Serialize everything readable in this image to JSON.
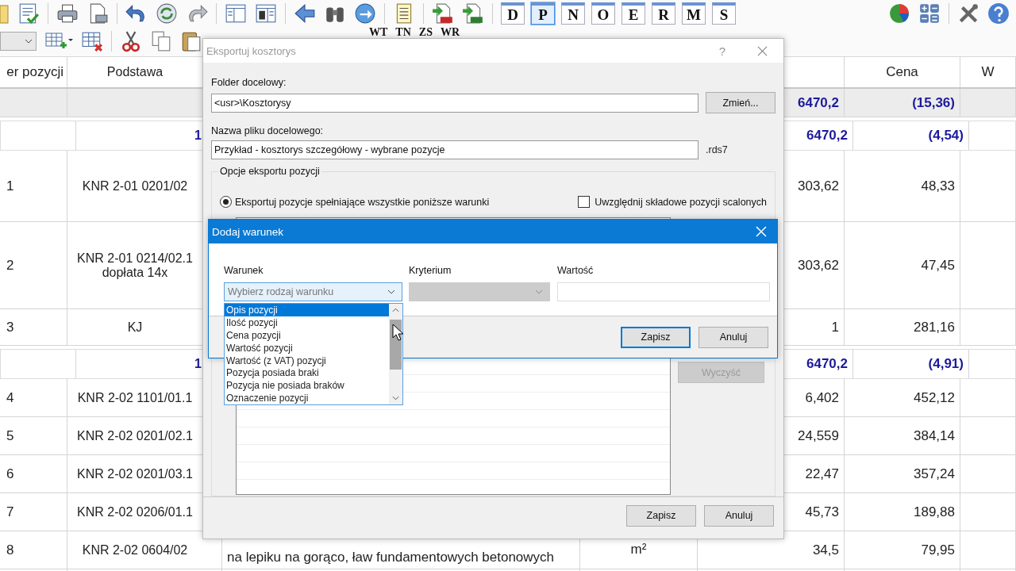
{
  "toolbar": {
    "letter_buttons": [
      {
        "label": "D",
        "selected": false
      },
      {
        "label": "P",
        "selected": true
      },
      {
        "label": "N",
        "selected": false
      },
      {
        "label": "O",
        "selected": false
      },
      {
        "label": "E",
        "selected": false
      },
      {
        "label": "R",
        "selected": false
      },
      {
        "label": "M",
        "selected": false
      },
      {
        "label": "S",
        "selected": false
      }
    ],
    "text_buttons": [
      "WT",
      "TN",
      "ZS",
      "WR"
    ]
  },
  "table": {
    "header": {
      "number": "er pozycji",
      "basis": "Podstawa",
      "price": "Cena",
      "column_7": "W"
    },
    "rows": [
      {
        "kind": "summary",
        "quantity": "6470,2",
        "price": "(15,36)"
      },
      {
        "kind": "group",
        "basis": "1",
        "quantity": "6470,2",
        "price": "(4,54)"
      },
      {
        "kind": "item",
        "number": "1",
        "basis": "KNR 2-01 0201/02",
        "quantity": "303,62",
        "price": "48,33"
      },
      {
        "kind": "item",
        "number": "2",
        "basis": "KNR 2-01 0214/02.1\ndopłata 14x",
        "quantity": "303,62",
        "price": "47,45"
      },
      {
        "kind": "item",
        "number": "3",
        "basis": "KJ",
        "quantity": "1",
        "price": "281,16"
      },
      {
        "kind": "group",
        "basis": "1",
        "quantity": "6470,2",
        "price": "(4,91)"
      },
      {
        "kind": "item",
        "number": "4",
        "basis": "KNR 2-02 1101/01.1",
        "quantity": "6,402",
        "price": "452,12"
      },
      {
        "kind": "item",
        "number": "5",
        "basis": "KNR 2-02 0201/02.1",
        "quantity": "24,559",
        "price": "384,14"
      },
      {
        "kind": "item",
        "number": "6",
        "basis": "KNR 2-02 0201/03.1",
        "quantity": "22,47",
        "price": "357,24"
      },
      {
        "kind": "item",
        "number": "7",
        "basis": "KNR 2-02 0206/01.1",
        "quantity": "45,73",
        "price": "189,88"
      },
      {
        "kind": "item",
        "number": "8",
        "basis": "KNR 2-02 0604/02",
        "description": "na lepiku na gorąco, ław fundamentowych betonowych",
        "unit": "m²",
        "quantity": "34,5",
        "price": "79,95"
      },
      {
        "kind": "item"
      }
    ]
  },
  "export_dialog": {
    "title": "Eksportuj kosztorys",
    "help": "?",
    "folder_label": "Folder docelowy:",
    "folder_value": "<usr>\\Kosztorysy",
    "change_button": "Zmień...",
    "file_label": "Nazwa pliku docelowego:",
    "file_value": "Przykład - kosztorys szczegółowy - wybrane pozycje",
    "extension": ".rds7",
    "group_title": "Opcje eksportu pozycji",
    "match_all": {
      "label": "Eksportuj pozycje spełniające wszystkie poniższe warunki",
      "selected": true
    },
    "include_merged": {
      "label": "Uwzględnij składowe pozycji scalonych",
      "checked": false
    },
    "clear_button": {
      "label": "Wyczyść",
      "disabled": true
    },
    "buttons": [
      {
        "label": "Zapisz",
        "default": false
      },
      {
        "label": "Anuluj",
        "default": false
      }
    ]
  },
  "condition_dialog": {
    "title": "Dodaj warunek",
    "condition": {
      "label": "Warunek",
      "placeholder": "Wybierz rodzaj warunku",
      "expanded": true
    },
    "criterion": {
      "label": "Kryterium",
      "disabled": true
    },
    "value": {
      "label": "Wartość"
    },
    "options": [
      {
        "label": "Opis pozycji",
        "selected": true
      },
      {
        "label": "Ilość pozycji",
        "selected": false
      },
      {
        "label": "Cena pozycji",
        "selected": false
      },
      {
        "label": "Wartość pozycji",
        "selected": false
      },
      {
        "label": "Wartość (z VAT) pozycji",
        "selected": false
      },
      {
        "label": "Pozycja posiada braki",
        "selected": false
      },
      {
        "label": "Pozycja nie posiada braków",
        "selected": false
      },
      {
        "label": "Oznaczenie pozycji",
        "selected": false
      }
    ],
    "buttons": [
      {
        "label": "Zapisz",
        "default": true
      },
      {
        "label": "Anuluj",
        "default": false
      }
    ]
  }
}
